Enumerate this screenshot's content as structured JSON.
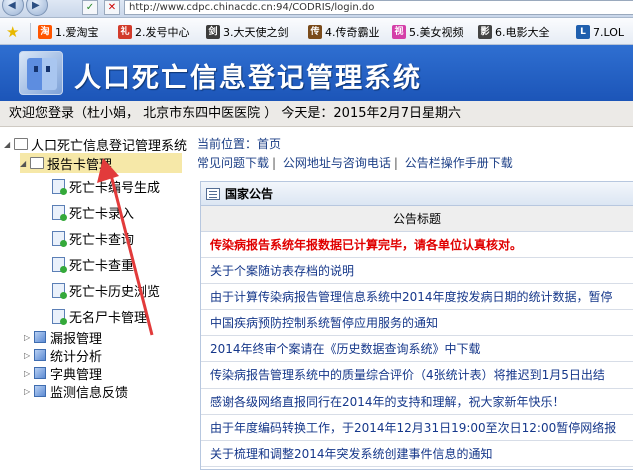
{
  "browser": {
    "url": "http://www.cdpc.chinacdc.cn:94/CODRIS/login.do",
    "favorites": [
      {
        "label": "1.爱淘宝",
        "icon": "taobao-icon",
        "color": "#ff5500",
        "glyph": "淘"
      },
      {
        "label": "2.发号中心",
        "icon": "gift-icon",
        "color": "#d23b2b",
        "glyph": "礼"
      },
      {
        "label": "3.大天使之剑",
        "icon": "game-icon",
        "color": "#3c3c3c",
        "glyph": "剑"
      },
      {
        "label": "4.传奇霸业",
        "icon": "game2-icon",
        "color": "#7a4b1b",
        "glyph": "传"
      },
      {
        "label": "5.美女视频",
        "icon": "video-icon",
        "color": "#d43fa8",
        "glyph": "视"
      },
      {
        "label": "6.电影大全",
        "icon": "film-icon",
        "color": "#444444",
        "glyph": "影"
      },
      {
        "label": "7.LOL",
        "icon": "lol-icon",
        "color": "#1f5fae",
        "glyph": "L"
      }
    ]
  },
  "app": {
    "title": "人口死亡信息登记管理系统",
    "welcome": "欢迎您登录（杜小娟， 北京市东四中医医院 ） 今天是：2015年2月7日星期六"
  },
  "tree": {
    "root": "人口死亡信息登记管理系统",
    "report_card": "报告卡管理",
    "children": [
      "死亡卡编号生成",
      "死亡卡录入",
      "死亡卡查询",
      "死亡卡查重",
      "死亡卡历史浏览",
      "无名尸卡管理"
    ],
    "groups": [
      "漏报管理",
      "统计分析",
      "字典管理",
      "监测信息反馈"
    ]
  },
  "main": {
    "location": "当前位置：首页",
    "links": [
      "常见问题下载",
      "公网地址与咨询电话",
      "公告栏操作手册下载"
    ],
    "panel_title": "国家公告",
    "column_header": "公告标题",
    "announcements": [
      "传染病报告系统年报数据已计算完毕，请各单位认真核对。",
      "关于个案随访表存档的说明",
      "由于计算传染病报告管理信息系统中2014年度按发病日期的统计数据，暂停",
      "中国疾病预防控制系统暂停应用服务的通知",
      "2014年终审个案请在《历史数据查询系统》中下载",
      "传染病报告管理系统中的质量综合评价（4张统计表）将推迟到1月5日出结",
      "感谢各级网络直报同行在2014年的支持和理解，祝大家新年快乐！",
      "由于年度编码转换工作，于2014年12月31日19:00至次日12:00暂停网络报",
      "关于梳理和调整2014年突发系统创建事件信息的通知"
    ]
  },
  "colors": {
    "header": "#1c55b8",
    "annotation_arrow": "#e23b3b",
    "highlight_text": "#e00000"
  }
}
